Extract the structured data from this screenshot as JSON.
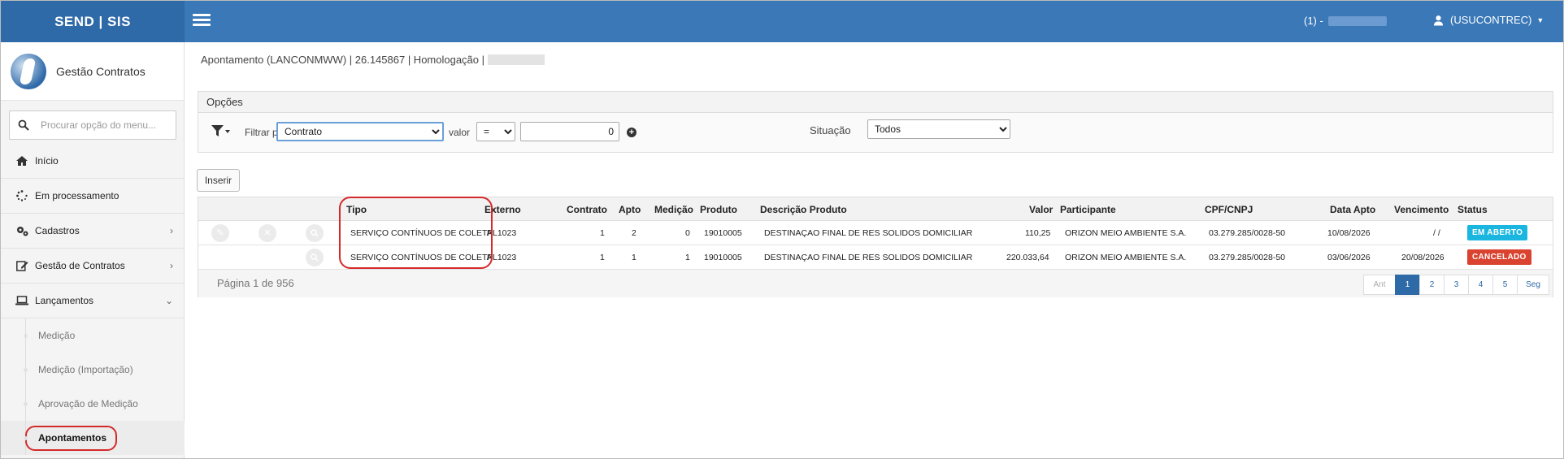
{
  "header": {
    "brand": "SEND | SIS",
    "environment": "(1) -",
    "user": "(USUCONTREC)",
    "colors": {
      "topbar": "#3a78b8",
      "brand_bg": "#2e69a8"
    }
  },
  "sidebar": {
    "app_title": "Gestão Contratos",
    "search_placeholder": "Procurar opção do menu...",
    "items": [
      {
        "label": "Início",
        "icon": "home-icon"
      },
      {
        "label": "Em processamento",
        "icon": "spinner-icon"
      },
      {
        "label": "Cadastros",
        "icon": "gears-icon",
        "chevron": "›"
      },
      {
        "label": "Gestão de Contratos",
        "icon": "edit-icon",
        "chevron": "›"
      },
      {
        "label": "Lançamentos",
        "icon": "laptop-icon",
        "chevron": "⌄"
      }
    ],
    "subitems": [
      {
        "label": "Medição"
      },
      {
        "label": "Medição (Importação)"
      },
      {
        "label": "Aprovação de Medição"
      },
      {
        "label": "Apontamentos"
      }
    ]
  },
  "breadcrumb": "Apontamento (LANCONMWW) | 26.145867 | Homologação |",
  "filters": {
    "title": "Opções",
    "filter_label": "Filtrar por",
    "filter_field": "Contrato",
    "value_label": "valor",
    "operator": "=",
    "value": "0",
    "plus": "+",
    "situation_label": "Situação",
    "situation": "Todos"
  },
  "insert_button": "Inserir",
  "table": {
    "columns": [
      "Tipo",
      "Externo",
      "Contrato",
      "Apto",
      "Medição",
      "Produto",
      "Descrição Produto",
      "Valor",
      "Participante",
      "CPF/CNPJ",
      "Data Apto",
      "Vencimento",
      "Status"
    ],
    "rows": [
      {
        "tipo": "SERVIÇO CONTÍNUOS DE COLETA",
        "externo": "PL1023",
        "contrato": "1",
        "apto": "2",
        "medicao": "0",
        "produto": "19010005",
        "descricao": "DESTINAÇAO FINAL DE RES SOLIDOS DOMICILIAR",
        "valor": "110,25",
        "participante": "ORIZON MEIO AMBIENTE S.A.",
        "cnpj": "03.279.285/0028-50",
        "data_apto": "10/08/2026",
        "vencimento": "/ /",
        "status": "EM ABERTO"
      },
      {
        "tipo": "SERVIÇO CONTÍNUOS DE COLETA",
        "externo": "PL1023",
        "contrato": "1",
        "apto": "1",
        "medicao": "1",
        "produto": "19010005",
        "descricao": "DESTINAÇAO FINAL DE RES SOLIDOS DOMICILIAR",
        "valor": "220.033,64",
        "participante": "ORIZON MEIO AMBIENTE S.A.",
        "cnpj": "03.279.285/0028-50",
        "data_apto": "03/06/2026",
        "vencimento": "20/08/2026",
        "status": "CANCELADO"
      }
    ],
    "page_info": "Página 1 de 956",
    "pager": {
      "prev": "Ant",
      "pages": [
        "1",
        "2",
        "3",
        "4",
        "5"
      ],
      "next": "Seg"
    },
    "status_colors": {
      "open": "#1ab6e0",
      "cancel": "#d9432f"
    }
  }
}
